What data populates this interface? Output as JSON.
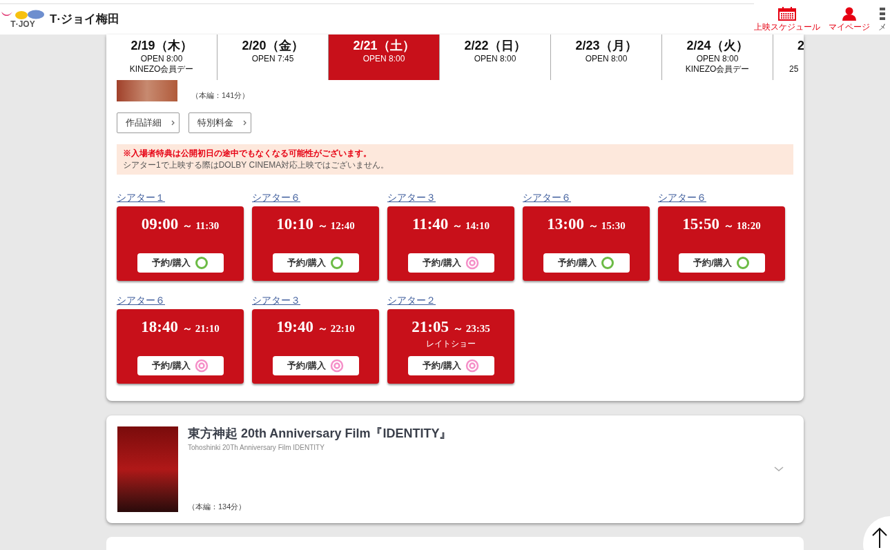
{
  "header": {
    "logo_mark": "T·JOY",
    "site_name": "T·ジョイ梅田",
    "nav": [
      {
        "kind": "calendar",
        "label": "上映スケジュール"
      },
      {
        "kind": "person",
        "label": "マイページ"
      },
      {
        "kind": "menu",
        "label": "メ"
      }
    ]
  },
  "dates": [
    {
      "date": "2/19（木）",
      "open": "OPEN 8:00",
      "note": "KINEZO会員デー",
      "selected": false
    },
    {
      "date": "2/20（金）",
      "open": "OPEN 7:45",
      "selected": false
    },
    {
      "date": "2/21（土）",
      "open": "OPEN 8:00",
      "selected": true
    },
    {
      "date": "2/22（日）",
      "open": "OPEN 8:00",
      "selected": false
    },
    {
      "date": "2/23（月）",
      "open": "OPEN 8:00",
      "selected": false
    },
    {
      "date": "2/24（火）",
      "open": "OPEN 8:00",
      "note": "KINEZO会員デー",
      "selected": false
    },
    {
      "date": "2",
      "note": "25",
      "selected": false
    }
  ],
  "films": [
    {
      "runtime": "（本編：141分）",
      "links": [
        "作品詳細",
        "特別料金"
      ],
      "notice": {
        "warning": "※入場者特典は公開初日の途中でもなくなる可能性がございます。",
        "info": "シアター1で上映する際はDOLBY CINEMA対応上映ではございません。"
      },
      "showtimes": [
        {
          "theater": "シアター１",
          "start": "09:00",
          "end": "～ 11:30",
          "button": "予約/購入",
          "kind": "circle"
        },
        {
          "theater": "シアター６",
          "start": "10:10",
          "end": "～ 12:40",
          "button": "予約/購入",
          "kind": "circle"
        },
        {
          "theater": "シアター３",
          "start": "11:40",
          "end": "～ 14:10",
          "button": "予約/購入",
          "kind": "double_circle"
        },
        {
          "theater": "シアター６",
          "start": "13:00",
          "end": "～ 15:30",
          "button": "予約/購入",
          "kind": "circle"
        },
        {
          "theater": "シアター６",
          "start": "15:50",
          "end": "～ 18:20",
          "button": "予約/購入",
          "kind": "circle"
        },
        {
          "theater": "シアター６",
          "start": "18:40",
          "end": "～ 21:10",
          "button": "予約/購入",
          "kind": "double_circle"
        },
        {
          "theater": "シアター３",
          "start": "19:40",
          "end": "～ 22:10",
          "button": "予約/購入",
          "kind": "double_circle"
        },
        {
          "theater": "シアター２",
          "start": "21:05",
          "end": "～ 23:35",
          "label": "レイトショー",
          "button": "予約/購入",
          "kind": "double_circle"
        }
      ]
    },
    {
      "title": "東方神起 20th Anniversary Film『IDENTITY』",
      "subtitle": "Tohoshinki 20Th Anniversary Film IDENTITY",
      "runtime": "（本編：134分）",
      "expanded": false
    }
  ]
}
